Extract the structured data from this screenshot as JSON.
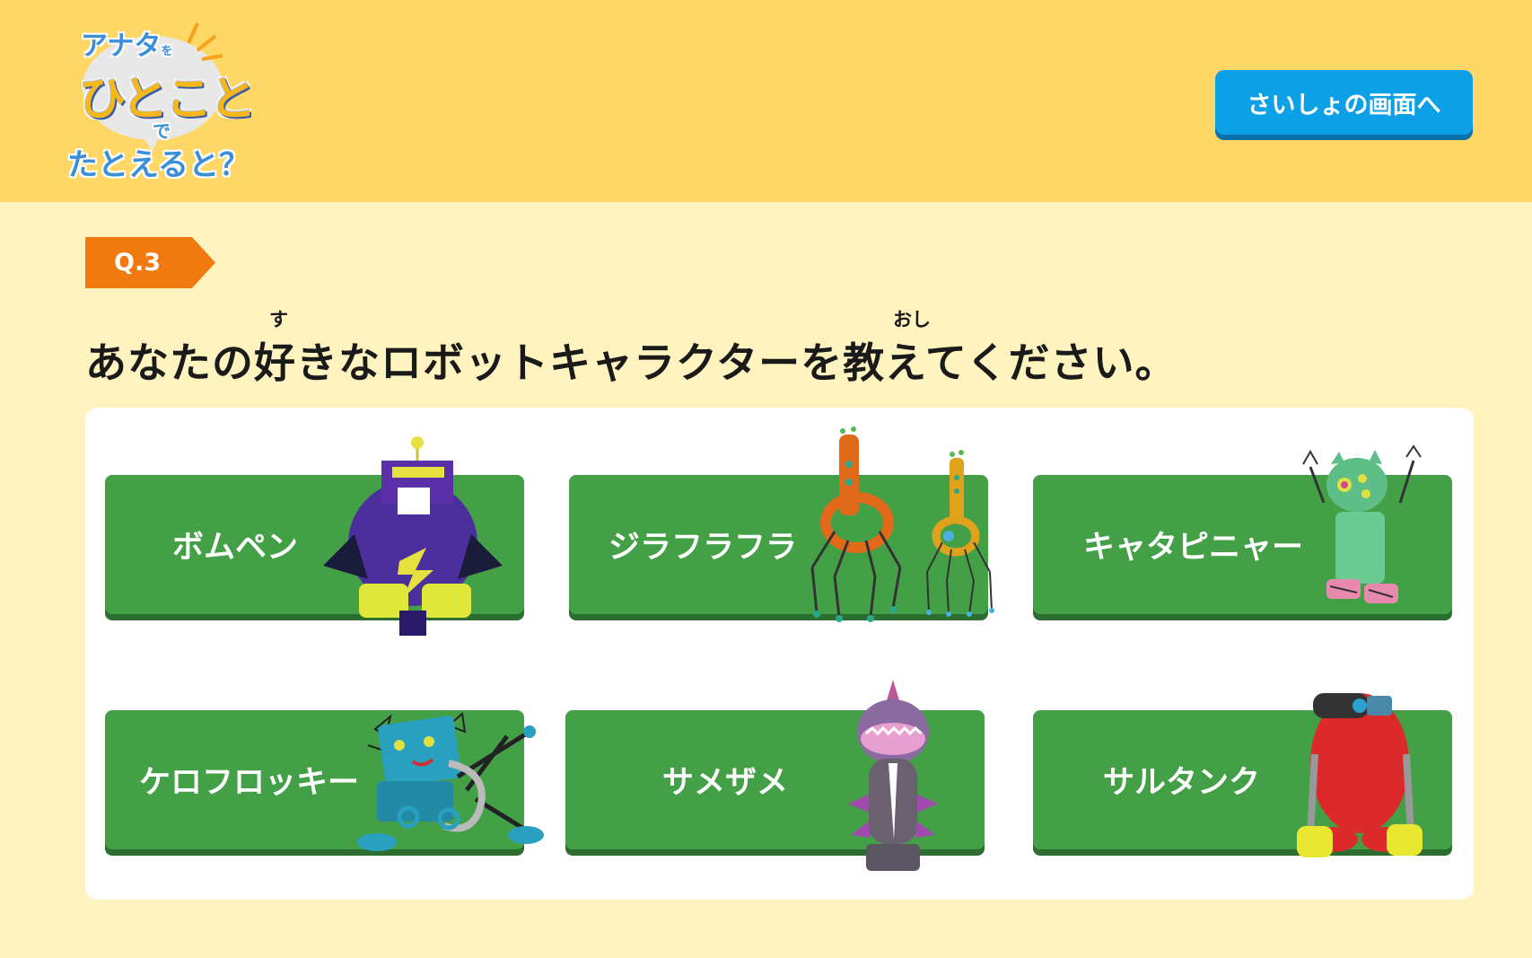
{
  "header": {
    "logo": {
      "line1": "アナタ",
      "line1_small": "を",
      "line2": "ひとこと",
      "line3": "で",
      "line4": "たとえると？"
    },
    "back_button": "さいしょの画面へ"
  },
  "question": {
    "number": "Q.3",
    "text": "あなたの好きなロボットキャラクターを教えてください。",
    "ruby": {
      "suki": "す",
      "oshieru": "おし"
    }
  },
  "choices": [
    {
      "label": "ボムペン",
      "robot": "bomupen-robot"
    },
    {
      "label": "ジラフラフラ",
      "robot": "jirafurafura-robot"
    },
    {
      "label": "キャタピニャー",
      "robot": "kyatapinya-robot"
    },
    {
      "label": "ケロフロッキー",
      "robot": "kerofurokki-robot"
    },
    {
      "label": "サメザメ",
      "robot": "samezame-robot"
    },
    {
      "label": "サルタンク",
      "robot": "torutanku-robot"
    }
  ],
  "colors": {
    "header_bg": "#ffd766",
    "page_bg": "#fff4bf",
    "button_green": "#43a047",
    "back_button_blue": "#0da0e6",
    "question_tag_orange": "#f07a0f"
  }
}
